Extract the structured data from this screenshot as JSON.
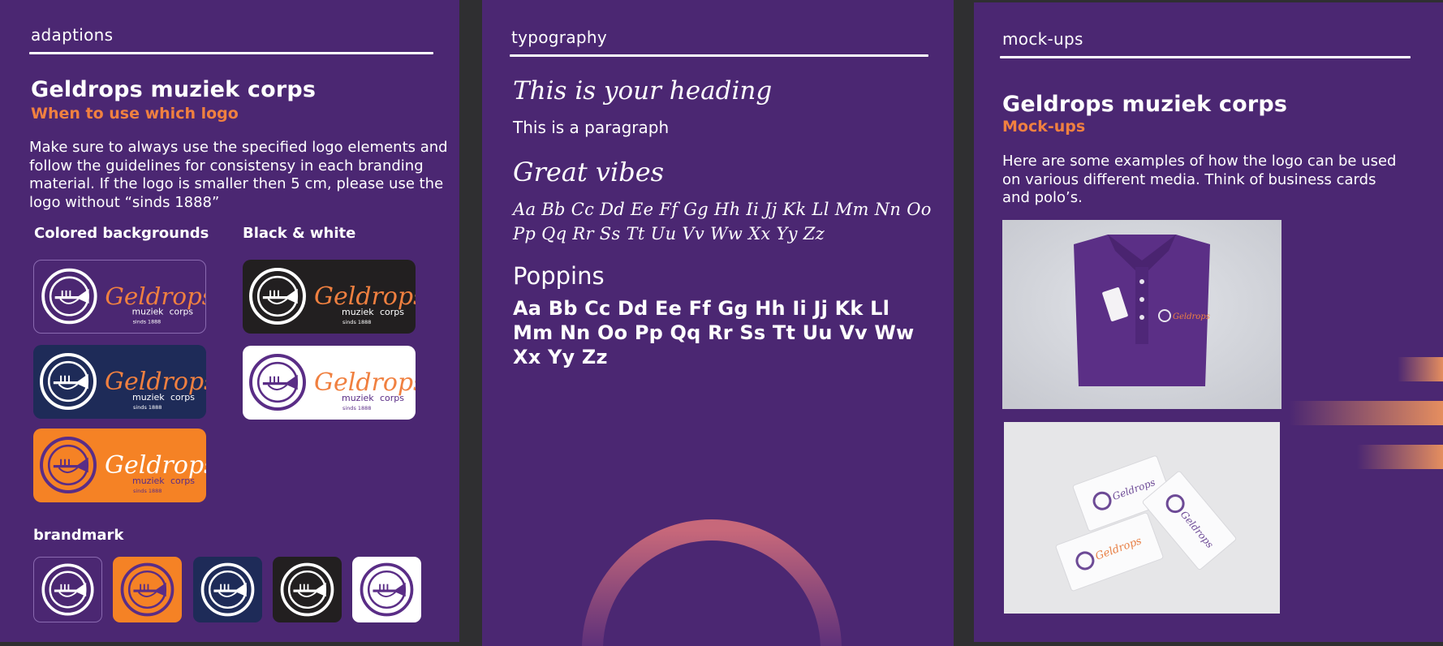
{
  "panels": {
    "adaptions": {
      "title": "adaptions",
      "heading": "Geldrops muziek corps",
      "subheading": "When to use which logo",
      "paragraph": "Make sure to always use the specified logo elements and follow the guidelines for consistensy in each branding material. If the logo is smaller then 5 cm, please use the logo without “sinds 1888”",
      "colored_label": "Colored backgrounds",
      "bw_label": "Black & white",
      "brandmark_label": "brandmark",
      "logo_text": {
        "script": "Geldrops",
        "line2a": "muziek",
        "line2b": "corps",
        "line3": "sinds 1888"
      }
    },
    "typography": {
      "title": "typography",
      "heading_sample": "This is your heading",
      "paragraph_sample": "This is a paragraph",
      "script_font_name": "Great vibes",
      "script_alphabet": "Aa Bb Cc Dd Ee Ff Gg Hh Ii Jj Kk Ll Mm Nn Oo Pp Qq Rr Ss Tt Uu Vv Ww Xx Yy Zz",
      "sans_font_name": "Poppins",
      "sans_alphabet": "Aa Bb Cc Dd Ee Ff Gg Hh Ii Jj Kk Ll Mm Nn Oo Pp Qq Rr Ss Tt Uu Vv Ww Xx Yy Zz"
    },
    "mockups": {
      "title": "mock-ups",
      "heading": "Geldrops muziek corps",
      "subheading": "Mock-ups",
      "paragraph": "Here are some examples of how the logo can be used on various different media. Think of business cards and polo’s."
    }
  },
  "colors": {
    "panel_bg": "#4b2772",
    "page_bg": "#2f2f31",
    "accent_orange": "#f08040",
    "navy": "#1e2b58",
    "black": "#221f20",
    "white": "#ffffff",
    "orange_bg": "#f58225",
    "purple_mark": "#5a2d86"
  }
}
